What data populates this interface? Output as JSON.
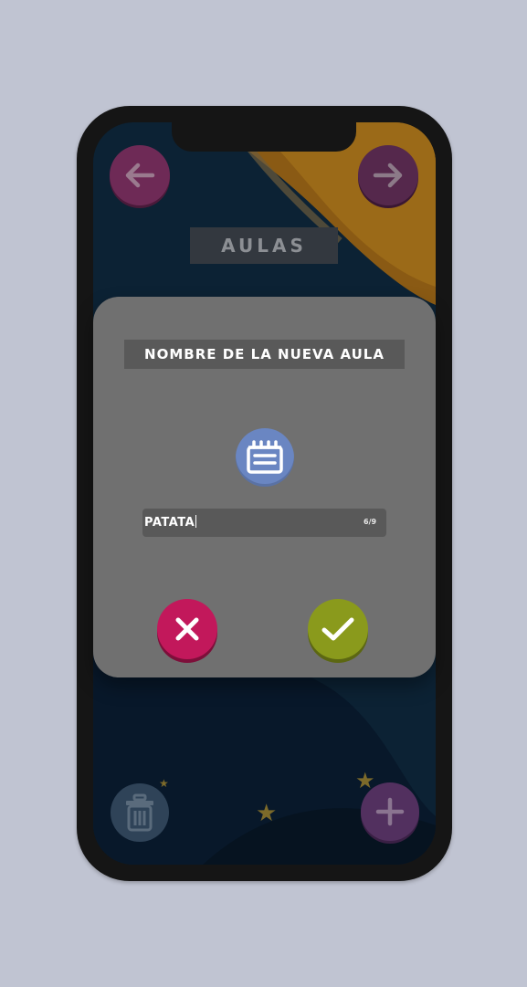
{
  "app": {
    "title": "AULAS"
  },
  "nav": {
    "back_icon": "arrow-left-icon",
    "forward_icon": "arrow-right-icon"
  },
  "bottom_bar": {
    "delete_icon": "trash-icon",
    "add_icon": "plus-icon"
  },
  "dialog": {
    "title": "NOMBRE DE LA NUEVA AULA",
    "class_icon": "classroom-board-icon",
    "input_value": "PATATA",
    "char_counter": "6/9",
    "cancel_icon": "close-icon",
    "confirm_icon": "check-icon"
  },
  "colors": {
    "background": "#c0c4d2",
    "phone_frame": "#151515",
    "screen_bg": "#0c2234",
    "dialog_bg": "#707070",
    "dialog_field_bg": "#595959",
    "cancel_accent": "#c2185b",
    "confirm_accent": "#8a9a1c",
    "class_icon_accent": "#6a86c2"
  }
}
